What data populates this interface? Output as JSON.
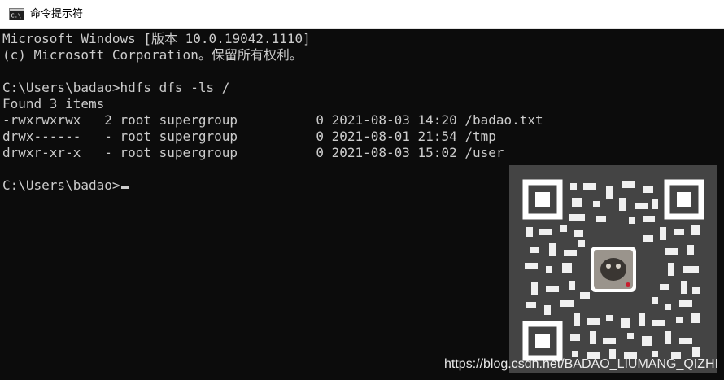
{
  "window": {
    "title": "命令提示符",
    "app_icon": "cmd-icon"
  },
  "console": {
    "lines": [
      "Microsoft Windows [版本 10.0.19042.1110]",
      "(c) Microsoft Corporation。保留所有权利。",
      "",
      "C:\\Users\\badao>hdfs dfs -ls /",
      "Found 3 items",
      "-rwxrwxrwx   2 root supergroup          0 2021-08-03 14:20 /badao.txt",
      "drwx------   - root supergroup          0 2021-08-01 21:54 /tmp",
      "drwxr-xr-x   - root supergroup          0 2021-08-03 15:02 /user",
      ""
    ],
    "prompt": "C:\\Users\\badao>"
  },
  "overlay": {
    "qr_icon": "qr-code-icon",
    "watermark": "https://blog.csdn.net/BADAO_LIUMANG_QIZHI"
  },
  "colors": {
    "console_bg": "#0c0c0c",
    "console_text": "#cccccc",
    "titlebar_bg": "#ffffff"
  }
}
